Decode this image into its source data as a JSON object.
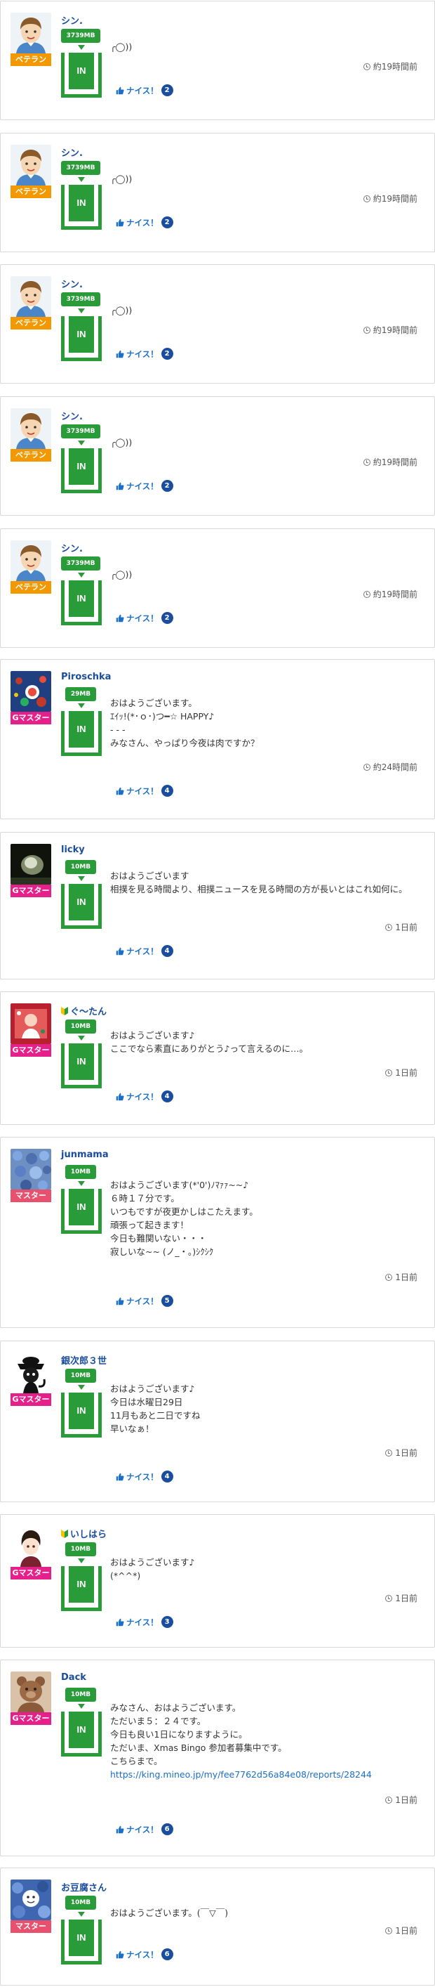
{
  "nice_label": "ナイス！",
  "posts": [
    {
      "name": "シン.",
      "leaf": false,
      "avatar": "boy",
      "rank": "ベテラン",
      "rank_type": "veteran",
      "mb": "3739MB",
      "in": "IN",
      "text": "╭◯))",
      "time": "約19時間前",
      "nice": "2"
    },
    {
      "name": "シン.",
      "leaf": false,
      "avatar": "boy",
      "rank": "ベテラン",
      "rank_type": "veteran",
      "mb": "3739MB",
      "in": "IN",
      "text": "╭◯))",
      "time": "約19時間前",
      "nice": "2"
    },
    {
      "name": "シン.",
      "leaf": false,
      "avatar": "boy",
      "rank": "ベテラン",
      "rank_type": "veteran",
      "mb": "3739MB",
      "in": "IN",
      "text": "╭◯))",
      "time": "約19時間前",
      "nice": "2"
    },
    {
      "name": "シン.",
      "leaf": false,
      "avatar": "boy",
      "rank": "ベテラン",
      "rank_type": "veteran",
      "mb": "3739MB",
      "in": "IN",
      "text": "╭◯))",
      "time": "約19時間前",
      "nice": "2"
    },
    {
      "name": "シン.",
      "leaf": false,
      "avatar": "boy",
      "rank": "ベテラン",
      "rank_type": "veteran",
      "mb": "3739MB",
      "in": "IN",
      "text": "╭◯))",
      "time": "約19時間前",
      "nice": "2"
    },
    {
      "name": "Piroschka",
      "leaf": false,
      "avatar": "xmas",
      "rank": "Gマスター",
      "rank_type": "gmaster",
      "mb": "29MB",
      "in": "IN",
      "text": "おはようございます。\nｴｲｯ!(*･ｏ･)つ━☆ HAPPY♪\n- - -\nみなさん、やっぱり今夜は肉ですか？",
      "time": "約24時間前",
      "nice": "4"
    },
    {
      "name": "licky",
      "leaf": false,
      "avatar": "dark",
      "rank": "Gマスター",
      "rank_type": "gmaster",
      "mb": "10MB",
      "in": "IN",
      "text": "おはようございます\n相撲を見る時間より、相撲ニュースを見る時間の方が長いとはこれ如何に。",
      "time": "1日前",
      "nice": "4"
    },
    {
      "name": "ぐ〜たん",
      "leaf": true,
      "avatar": "red",
      "rank": "Gマスター",
      "rank_type": "gmaster",
      "mb": "10MB",
      "in": "IN",
      "text": "おはようございます♪\nここでなら素直にありがとう♪って言えるのに…。",
      "time": "1日前",
      "nice": "4"
    },
    {
      "name": "junmama",
      "leaf": false,
      "avatar": "flowers",
      "rank": "マスター",
      "rank_type": "master",
      "mb": "10MB",
      "in": "IN",
      "text": "おはようございます(*'0')ﾉﾏｧｧ~~♪\n６時１７分です。\nいつもですが夜更かしはこたえます。\n頑張って起きます！\n今日も難関いない・・・\n寂しいな~~ (ノ_・｡)ｼｸｼｸ",
      "time": "1日前",
      "nice": "5"
    },
    {
      "name": "銀次郎３世",
      "leaf": false,
      "avatar": "cat",
      "rank": "Gマスター",
      "rank_type": "gmaster",
      "mb": "10MB",
      "in": "IN",
      "text": "おはようございます♪\n今日は水曜日29日\n11月もあと二日ですね\n早いなぁ！",
      "time": "1日前",
      "nice": "4"
    },
    {
      "name": "いしはら",
      "leaf": true,
      "avatar": "anime",
      "rank": "Gマスター",
      "rank_type": "gmaster",
      "mb": "10MB",
      "in": "IN",
      "text": "おはようございます♪\n(*^^*)",
      "time": "1日前",
      "nice": "3"
    },
    {
      "name": "Dack",
      "leaf": false,
      "avatar": "bear",
      "rank": "Gマスター",
      "rank_type": "gmaster",
      "mb": "10MB",
      "in": "IN",
      "text": "みなさん、おはようございます。\nただいま５：２４です。\n今日も良い1日になりますように。\nただいま、Xmas Bingo 参加者募集中です。\nこちらまで。",
      "link": "https://king.mineo.jp/my/fee7762d56a84e08/reports/28244",
      "time": "1日前",
      "nice": "6"
    },
    {
      "name": "お豆腐さん",
      "leaf": false,
      "avatar": "flowers2",
      "rank": "マスター",
      "rank_type": "master",
      "mb": "10MB",
      "in": "IN",
      "text": "おはようございます。(￣▽￣)",
      "time": "1日前",
      "nice": "6"
    }
  ]
}
